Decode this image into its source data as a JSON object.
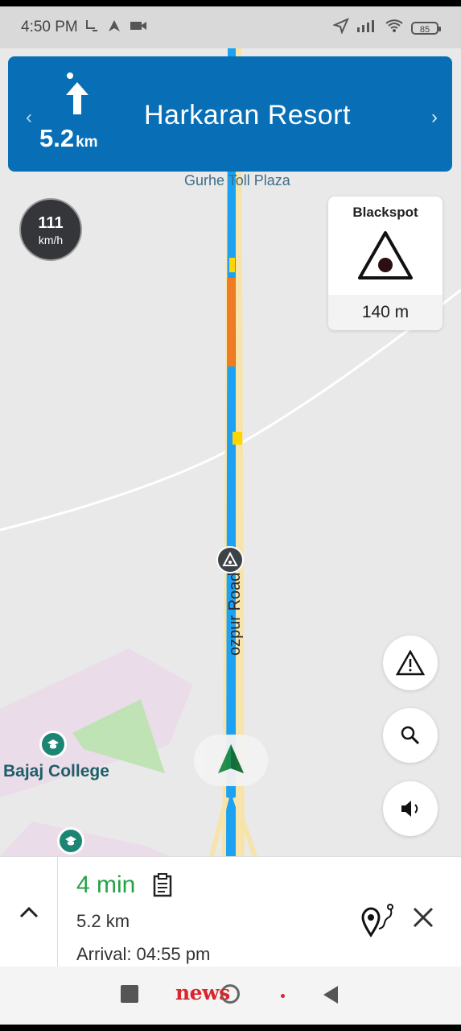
{
  "status_bar": {
    "time": "4:50 PM",
    "battery": "85",
    "icons": [
      "usb-icon",
      "navigation-arrow-icon",
      "video-camera-icon",
      "location-icon",
      "signal-icon",
      "wifi-icon",
      "battery-icon"
    ]
  },
  "navigation": {
    "distance": "5.2",
    "distance_unit": "km",
    "destination": "Harkaran Resort",
    "direction_icon": "straight-arrow-icon"
  },
  "map": {
    "toll_label": "Gurhe Toll Plaza",
    "road_label": "ozpur Road",
    "poi_label": "Bajaj College",
    "speed": {
      "value": "111",
      "unit": "km/h"
    }
  },
  "blackspot": {
    "title": "Blackspot",
    "distance": "140 m"
  },
  "trip": {
    "eta": "4 min",
    "distance": "5.2 km",
    "arrival": "Arrival: 04:55 pm"
  },
  "colors": {
    "banner": "#086fb6",
    "route": "#1da1f2",
    "eta": "#25a244",
    "map_background": "#e9e9ea"
  },
  "watermark": "news"
}
